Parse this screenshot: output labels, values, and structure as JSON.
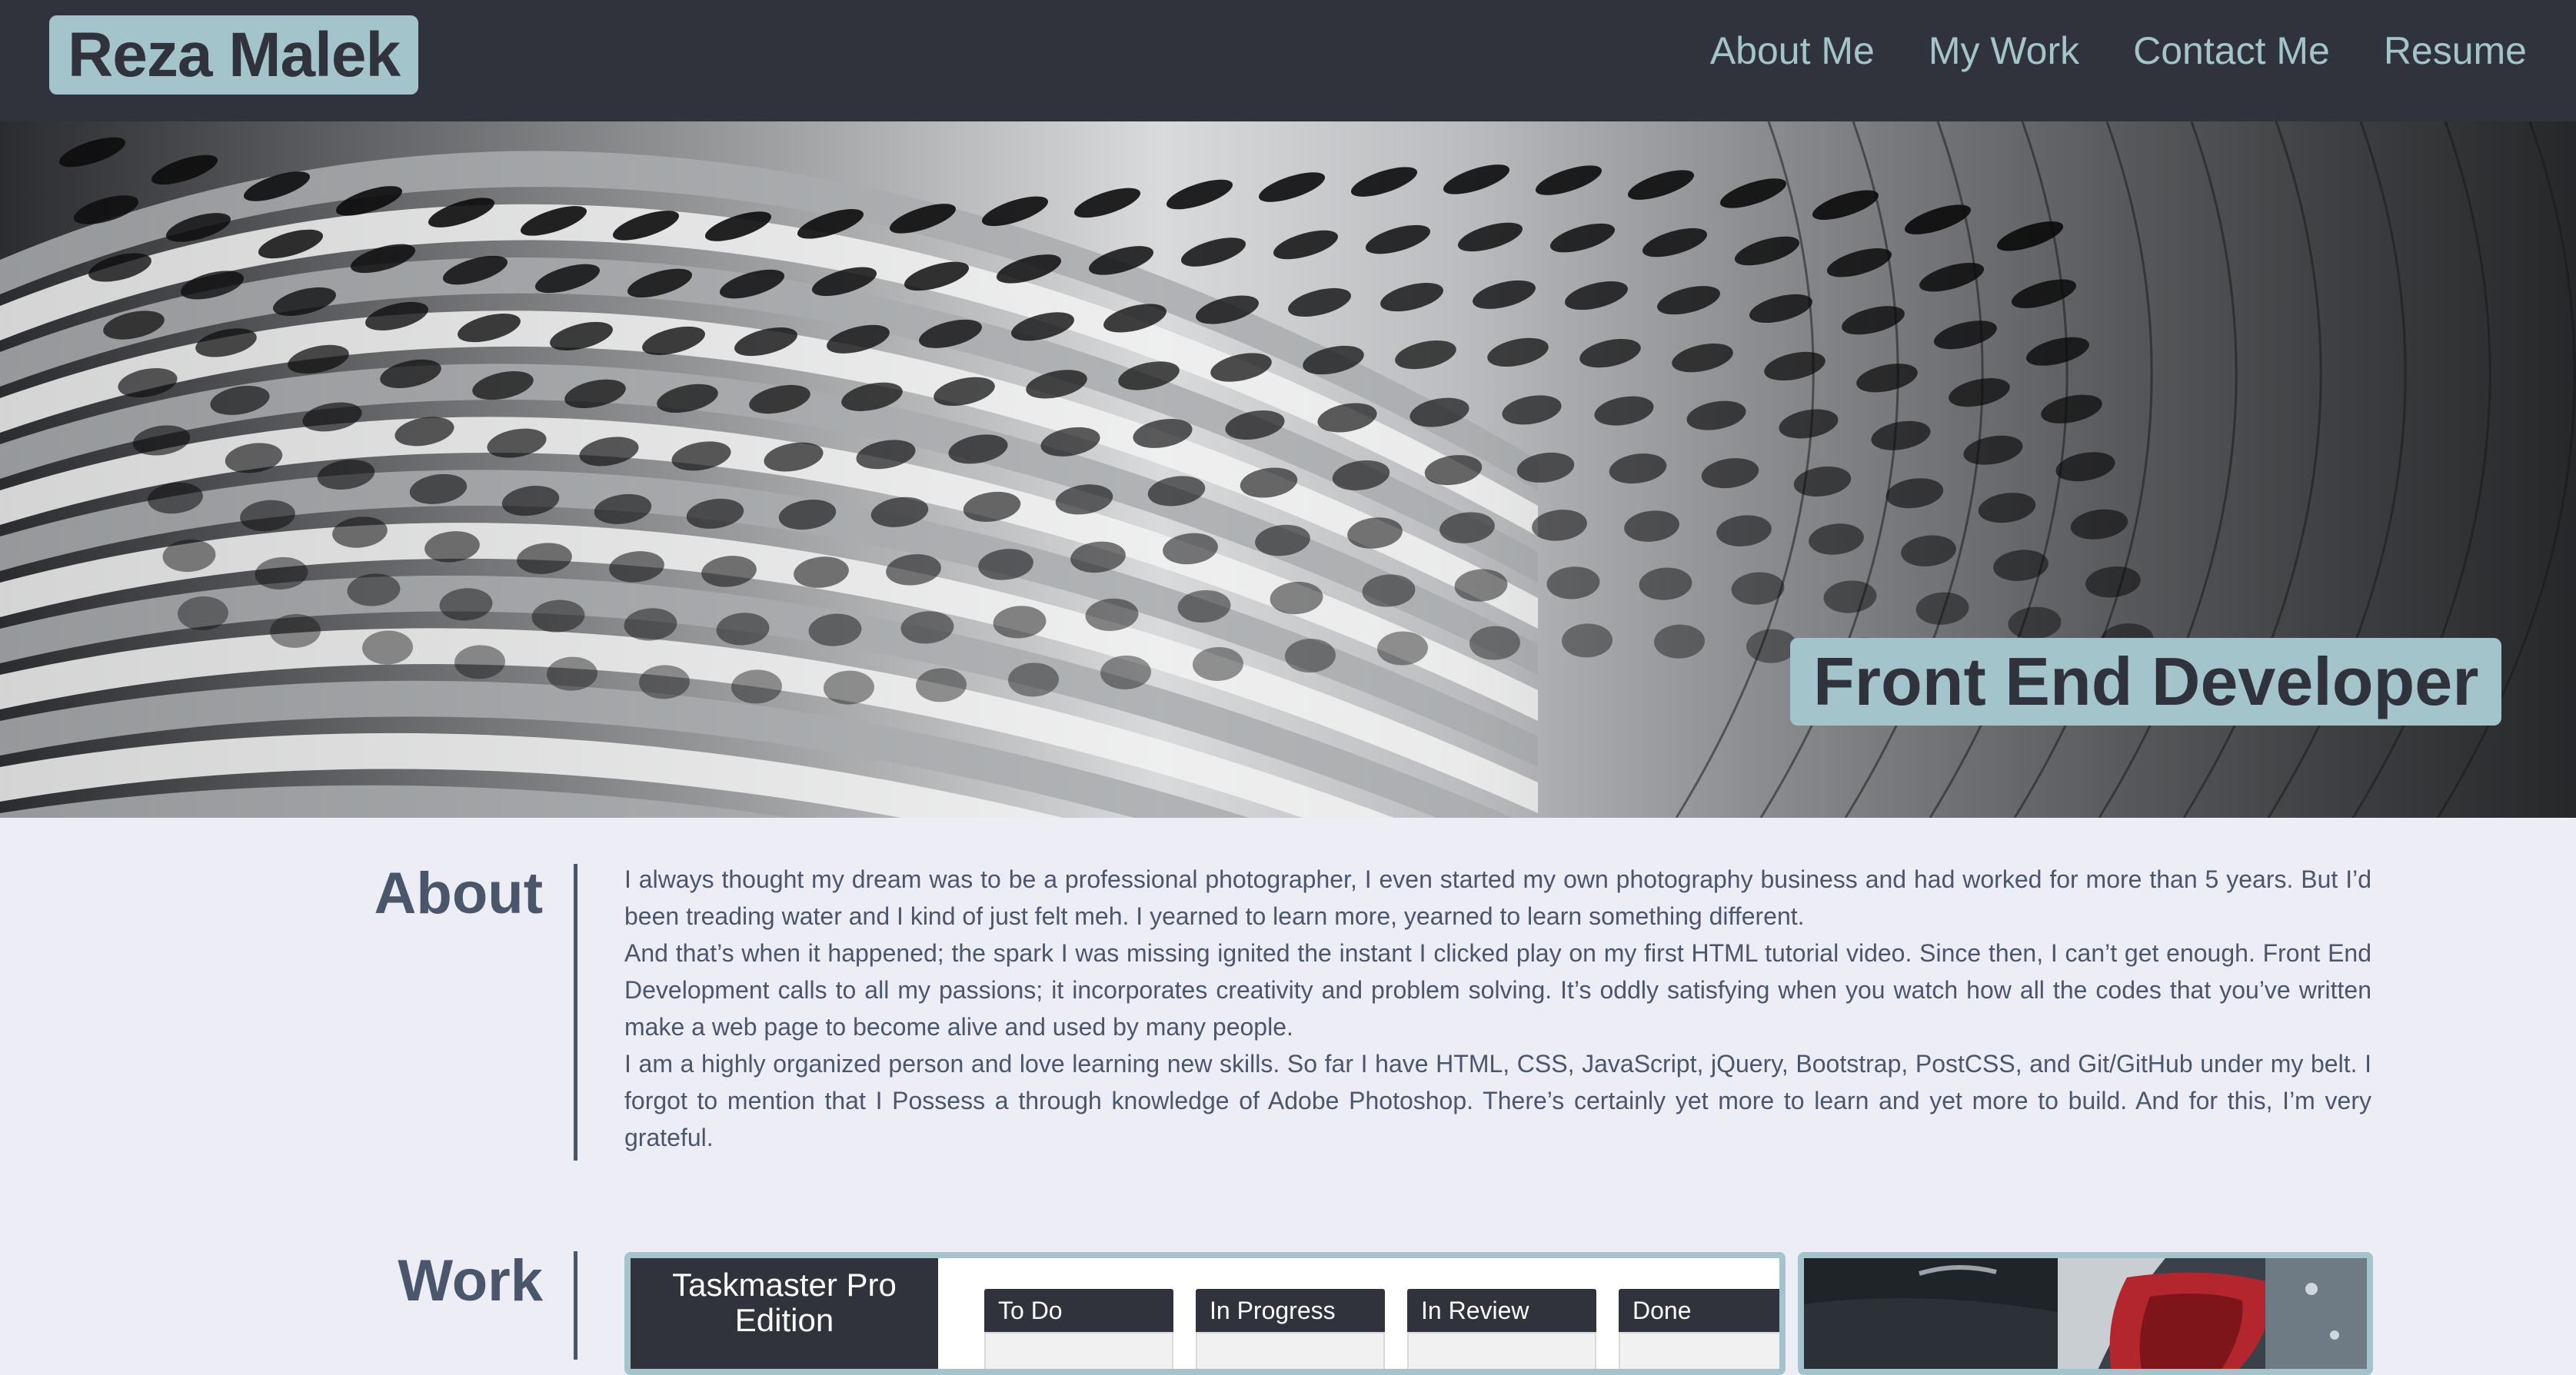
{
  "header": {
    "brand": "Reza Malek",
    "nav": [
      "About Me",
      "My Work",
      "Contact Me",
      "Resume"
    ]
  },
  "hero": {
    "badge": "Front End Developer"
  },
  "about": {
    "title": "About",
    "paragraphs": [
      "I always thought my dream was to be a professional photographer, I even started my own photography business and had worked for more than 5 years. But I’d been treading water and I kind of just felt meh. I yearned to learn more, yearned to learn something different.",
      "And that’s when it happened; the spark I was missing ignited the instant I clicked play on my first HTML tutorial video. Since then, I can’t get enough. Front End Development calls to all my passions; it incorporates creativity and problem solving. It’s oddly satisfying when you watch how all the codes that you’ve written make a web page to become alive and used by many people.",
      "I am a highly organized person and love learning new skills. So far I have HTML, CSS, JavaScript, jQuery, Bootstrap, PostCSS, and Git/GitHub under my belt. I forgot to mention that I Possess a through knowledge of Adobe Photoshop. There’s certainly yet more to learn and yet more to build. And for this, I’m very grateful."
    ]
  },
  "work": {
    "title": "Work",
    "project": {
      "app_title": "Taskmaster Pro Edition",
      "columns": [
        "To Do",
        "In Progress",
        "In Review",
        "Done"
      ]
    },
    "side_project": {
      "image_icon": "car-taillight-photo"
    }
  },
  "colors": {
    "header_bg": "#30333b",
    "accent": "#a4c4cb",
    "page_bg": "#edeef5",
    "text": "#4a566b"
  }
}
